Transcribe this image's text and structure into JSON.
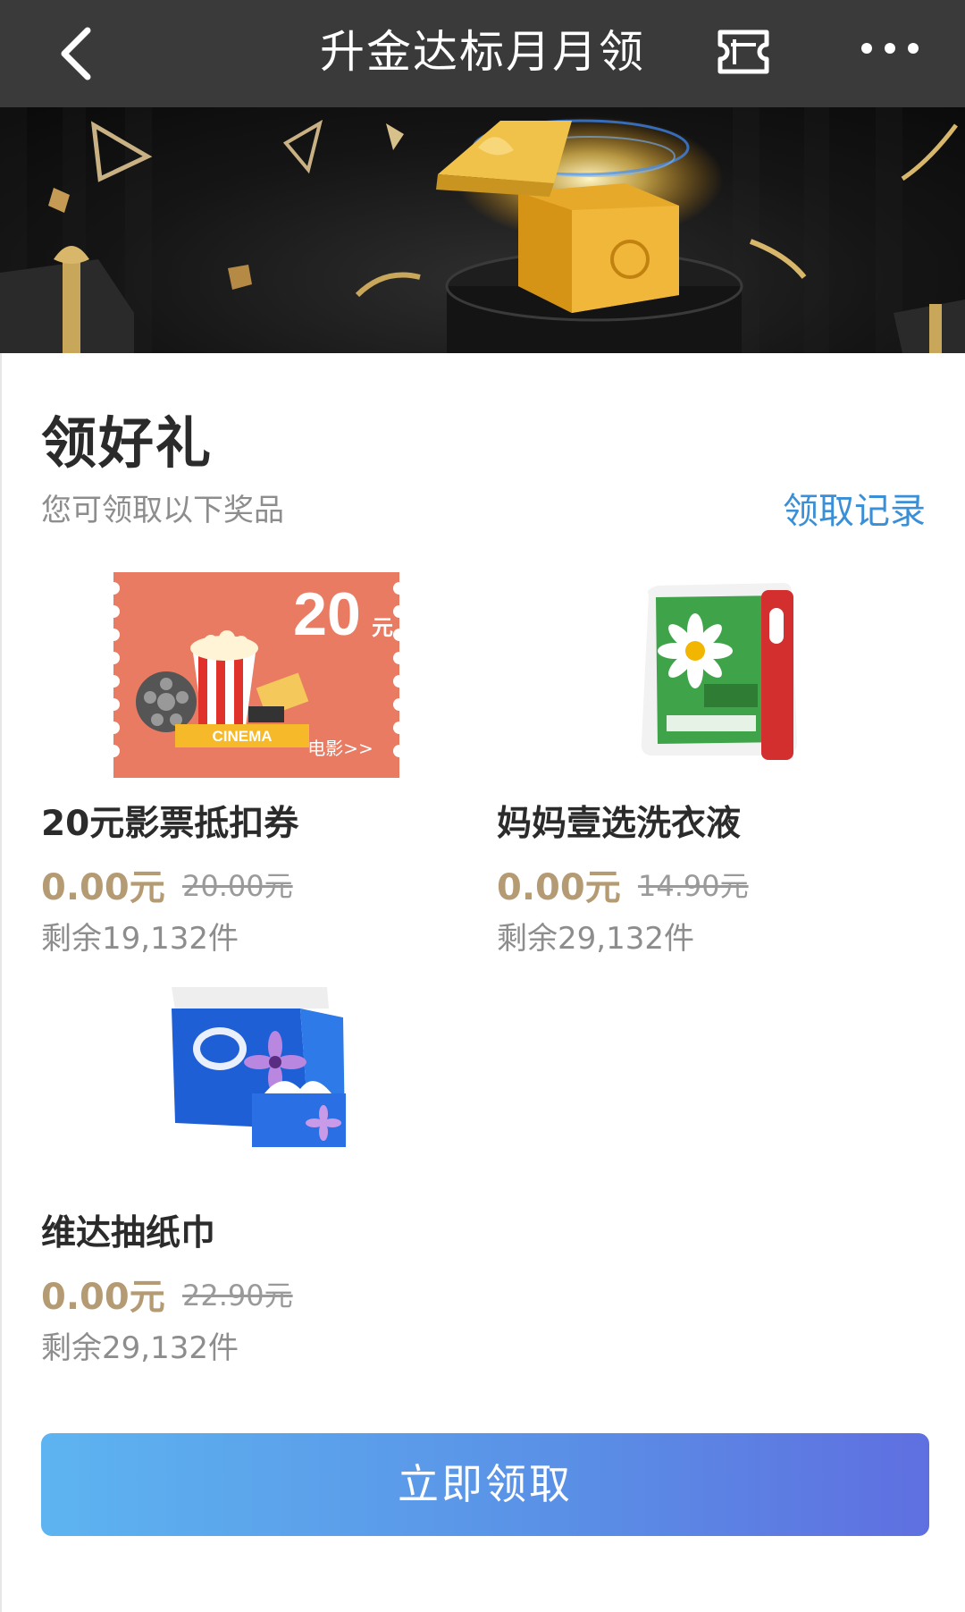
{
  "topbar": {
    "title": "升金达标月月领",
    "back_icon": "chevron-left-icon",
    "ticket_icon": "ticket-icon",
    "more_icon": "more-dots-icon"
  },
  "banner": {
    "image": "gift-box-banner"
  },
  "section": {
    "heading": "领好礼",
    "subtext": "您可领取以下奖品",
    "record_link": "领取记录"
  },
  "prizes": [
    {
      "name": "20元影票抵扣券",
      "price": "0.00元",
      "original_price": "20.00元",
      "remaining": "剩余19,132件",
      "coupon": {
        "amount": "20",
        "unit": "元",
        "tag": "CINEMA",
        "link": "电影>>"
      }
    },
    {
      "name": "妈妈壹选洗衣液",
      "price": "0.00元",
      "original_price": "14.90元",
      "remaining": "剩余29,132件"
    },
    {
      "name": "维达抽纸巾",
      "price": "0.00元",
      "original_price": "22.90元",
      "remaining": "剩余29,132件"
    }
  ],
  "claim_button": "立即领取",
  "colors": {
    "topbar_bg": "#3a3a3a",
    "price_gold": "#b59b74",
    "link_blue": "#3a8fd6",
    "coupon_bg": "#e97b63",
    "button_gradient_start": "#5db4f0",
    "button_gradient_end": "#5f6fe0"
  }
}
